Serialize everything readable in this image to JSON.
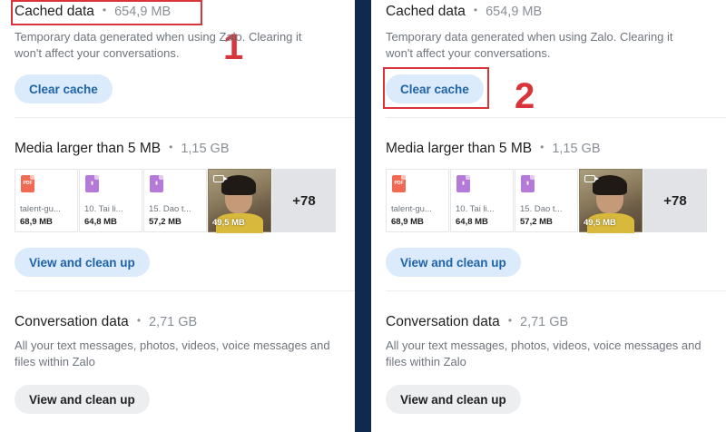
{
  "panels": [
    {
      "step_number": "1",
      "cached": {
        "title": "Cached data",
        "separator": "•",
        "size": "654,9 MB",
        "description": "Temporary data generated when using Zalo. Clearing it won't affect your conversations.",
        "button": "Clear cache"
      },
      "media": {
        "title": "Media larger than 5 MB",
        "separator": "•",
        "size": "1,15 GB",
        "files": [
          {
            "icon": "pdf-file-icon",
            "glyph": "PDF",
            "name": "talent-gu...",
            "size": "68,9 MB"
          },
          {
            "icon": "document-file-icon",
            "glyph": "▮",
            "name": "10. Tai li...",
            "size": "64,8 MB"
          },
          {
            "icon": "document-file-icon",
            "glyph": "▮",
            "name": "15. Dao t...",
            "size": "57,2 MB"
          }
        ],
        "video_size": "49,5 MB",
        "more": "+78",
        "button": "View and clean up"
      },
      "conversation": {
        "title": "Conversation data",
        "separator": "•",
        "size": "2,71 GB",
        "description": "All your text messages, photos, videos, voice messages and files within Zalo",
        "button": "View and clean up"
      }
    },
    {
      "step_number": "2",
      "cached": {
        "title": "Cached data",
        "separator": "•",
        "size": "654,9 MB",
        "description": "Temporary data generated when using Zalo. Clearing it won't affect your conversations.",
        "button": "Clear cache"
      },
      "media": {
        "title": "Media larger than 5 MB",
        "separator": "•",
        "size": "1,15 GB",
        "files": [
          {
            "icon": "pdf-file-icon",
            "glyph": "PDF",
            "name": "talent-gu...",
            "size": "68,9 MB"
          },
          {
            "icon": "document-file-icon",
            "glyph": "▮",
            "name": "10. Tai li...",
            "size": "64,8 MB"
          },
          {
            "icon": "document-file-icon",
            "glyph": "▮",
            "name": "15. Dao t...",
            "size": "57,2 MB"
          }
        ],
        "video_size": "49,5 MB",
        "more": "+78",
        "button": "View and clean up"
      },
      "conversation": {
        "title": "Conversation data",
        "separator": "•",
        "size": "2,71 GB",
        "description": "All your text messages, photos, videos, voice messages and files within Zalo",
        "button": "View and clean up"
      }
    }
  ],
  "colors": {
    "background": "#0f2a4e",
    "annotation_red": "#d9343a",
    "primary_button_bg": "#dcebfb",
    "primary_button_text": "#1e63a8",
    "secondary_button_bg": "#eceef0"
  }
}
